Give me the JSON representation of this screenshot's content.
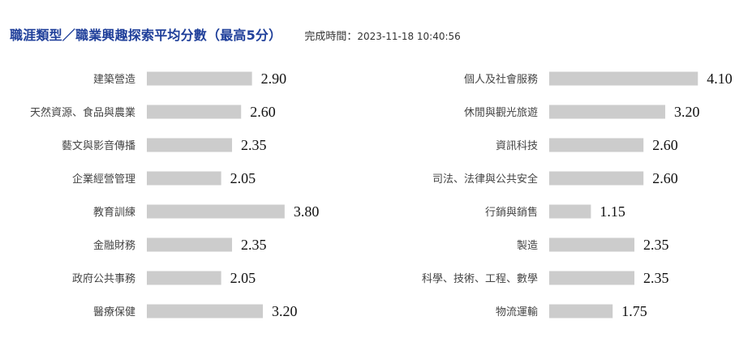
{
  "header": {
    "title": "職涯類型／職業興趣探索平均分數（最高5分）",
    "completed_label": "完成時間：",
    "completed_value": "2023-11-18  10:40:56"
  },
  "colors": {
    "title": "#1f3f9a",
    "bar": "#cccccc"
  },
  "chart_data": [
    {
      "type": "bar",
      "orientation": "horizontal",
      "xlim": [
        0,
        5
      ],
      "categories": [
        "建築營造",
        "天然資源、食品與農業",
        "藝文與影音傳播",
        "企業經營管理",
        "教育訓練",
        "金融財務",
        "政府公共事務",
        "醫療保健"
      ],
      "values": [
        2.9,
        2.6,
        2.35,
        2.05,
        3.8,
        2.35,
        2.05,
        3.2
      ],
      "value_labels": [
        "2.90",
        "2.60",
        "2.35",
        "2.05",
        "3.80",
        "2.35",
        "2.05",
        "3.20"
      ]
    },
    {
      "type": "bar",
      "orientation": "horizontal",
      "xlim": [
        0,
        5
      ],
      "categories": [
        "個人及社會服務",
        "休閒與觀光旅遊",
        "資訊科技",
        "司法、法律與公共安全",
        "行銷與銷售",
        "製造",
        "科學、技術、工程、數學",
        "物流運輸"
      ],
      "values": [
        4.1,
        3.2,
        2.6,
        2.6,
        1.15,
        2.35,
        2.35,
        1.75
      ],
      "value_labels": [
        "4.10",
        "3.20",
        "2.60",
        "2.60",
        "1.15",
        "2.35",
        "2.35",
        "1.75"
      ]
    }
  ]
}
